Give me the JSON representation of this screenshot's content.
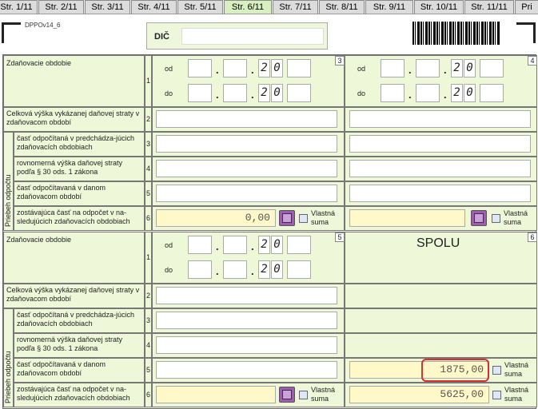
{
  "tabs": [
    "Str. 1/11",
    "Str. 2/11",
    "Str. 3/11",
    "Str. 4/11",
    "Str. 5/11",
    "Str. 6/11",
    "Str. 7/11",
    "Str. 8/11",
    "Str. 9/11",
    "Str. 10/11",
    "Str. 11/11",
    "Pri"
  ],
  "form_id": "DPPOv14_6",
  "dic_label": "DIČ",
  "labels": {
    "obdobie": "Zdaňovacie obdobie",
    "od": "od",
    "do": "do",
    "celkova": "Celková výška vykázanej daňovej straty v zdaňovacom období",
    "cast_odpocitana": "časť odpočítaná v predchádza-júcich zdaňovacích obdobiach",
    "rovnomerna": "rovnomerná výška daňovej straty podľa § 30 ods. 1 zákona",
    "cast_odpocitavana": "časť odpočítavaná v danom zdaňovacom období",
    "zostavajuca": "zostávajúca časť na odpočet v na-sledujúcich zdaňovacích obdobiach",
    "priebeh": "Priebeh odpočtu",
    "vlastna": "Vlastná suma",
    "spolu": "SPOLU"
  },
  "year_prefix": [
    "2",
    "0"
  ],
  "sections": [
    "3",
    "4",
    "5",
    "6"
  ],
  "row_numbers": [
    "1",
    "2",
    "3",
    "4",
    "5",
    "6"
  ],
  "values": {
    "s3_zostavajuca": "0,00",
    "s6_cast_odpocitavana": "1875,00",
    "s6_zostavajuca": "5625,00"
  }
}
